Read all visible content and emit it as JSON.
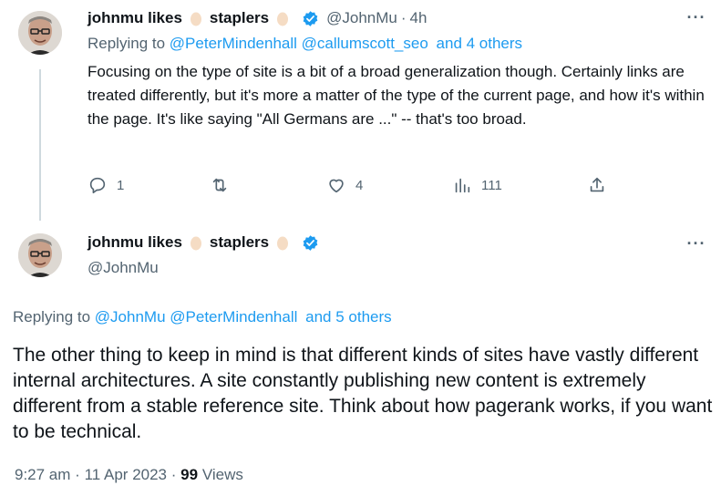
{
  "tweet1": {
    "author_name_a": "johnmu likes",
    "author_name_b": "staplers",
    "handle": "@JohnMu",
    "separator": "·",
    "time": "4h",
    "replying_prefix": "Replying to",
    "mention1": "@PeterMindenhall",
    "mention2": "@callumscott_seo",
    "others": "and 4 others",
    "text": "Focusing on the type of site is a bit of a broad generalization though. Certainly links are treated differently, but it's more a matter of the type of the current page, and how it's within the page. It's like saying \"All Germans are ...\" -- that's too broad.",
    "replies": "1",
    "likes": "4",
    "views": "111",
    "more": "···"
  },
  "tweet2": {
    "author_name_a": "johnmu likes",
    "author_name_b": "staplers",
    "handle": "@JohnMu",
    "replying_prefix": "Replying to",
    "mention1": "@JohnMu",
    "mention2": "@PeterMindenhall",
    "others": "and 5 others",
    "text": "The other thing to keep in mind is that different kinds of sites have vastly different internal architectures. A site constantly publishing new content is extremely different from a stable reference site. Think about how pagerank works, if you want to be technical.",
    "time": "9:27 am",
    "separator1": "·",
    "date": "11 Apr 2023",
    "separator2": "·",
    "views_count": "99",
    "views_label": "Views",
    "more": "···"
  },
  "colors": {
    "accent": "#1d9bf0",
    "muted": "#536471",
    "text": "#0f1419",
    "thread_line": "#cfd9de"
  },
  "icons": [
    "avatar",
    "egg-icon",
    "verified-badge-icon",
    "reply-icon",
    "retweet-icon",
    "like-icon",
    "views-icon",
    "share-icon",
    "more-icon"
  ]
}
